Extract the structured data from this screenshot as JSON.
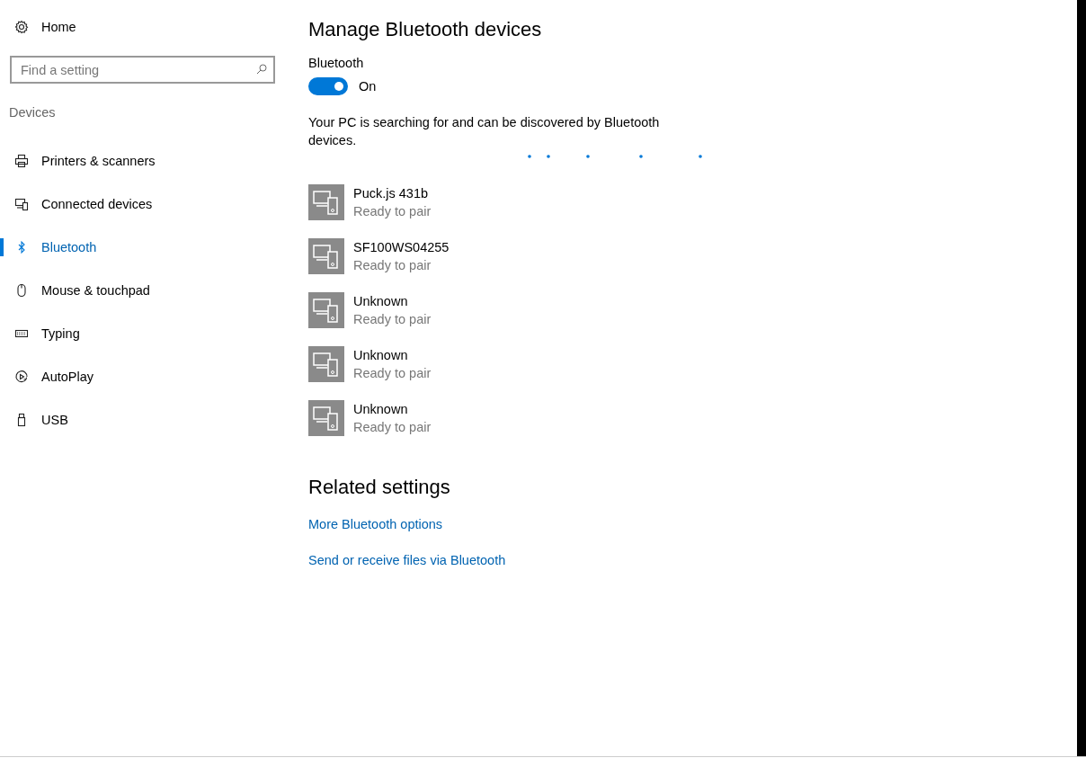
{
  "sidebar": {
    "home": {
      "label": "Home"
    },
    "search": {
      "placeholder": "Find a setting"
    },
    "section": "Devices",
    "items": [
      {
        "label": "Printers & scanners",
        "kind": "printer",
        "selected": false
      },
      {
        "label": "Connected devices",
        "kind": "devices",
        "selected": false
      },
      {
        "label": "Bluetooth",
        "kind": "bluetooth",
        "selected": true
      },
      {
        "label": "Mouse & touchpad",
        "kind": "mouse",
        "selected": false
      },
      {
        "label": "Typing",
        "kind": "keyboard",
        "selected": false
      },
      {
        "label": "AutoPlay",
        "kind": "autoplay",
        "selected": false
      },
      {
        "label": "USB",
        "kind": "usb",
        "selected": false
      }
    ]
  },
  "main": {
    "title": "Manage Bluetooth devices",
    "bluetooth": {
      "label": "Bluetooth",
      "on": true,
      "state_text": "On"
    },
    "description": "Your PC is searching for and can be discovered by Bluetooth devices.",
    "devices": [
      {
        "name": "Puck.js 431b",
        "status": "Ready to pair"
      },
      {
        "name": "SF100WS04255",
        "status": "Ready to pair"
      },
      {
        "name": "Unknown",
        "status": "Ready to pair"
      },
      {
        "name": "Unknown",
        "status": "Ready to pair"
      },
      {
        "name": "Unknown",
        "status": "Ready to pair"
      }
    ],
    "related": {
      "title": "Related settings",
      "links": [
        "More Bluetooth options",
        "Send or receive files via Bluetooth"
      ]
    }
  }
}
